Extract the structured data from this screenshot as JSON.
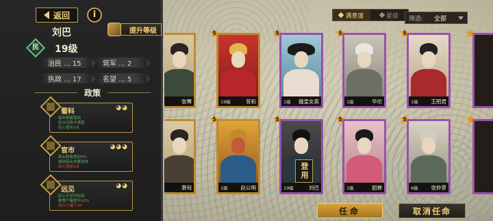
{
  "header": {
    "back_label": "返回",
    "info_label": "i",
    "hero_name": "刘巴",
    "upgrade_label": "提升等级",
    "class_label": "民",
    "level": "19级"
  },
  "stats": [
    {
      "label": "治民 ... 15"
    },
    {
      "label": "筑军 ... 2"
    },
    {
      "label": "执政 ... 17"
    },
    {
      "label": "名望 ... 5"
    }
  ],
  "policy_section_title": "政策",
  "policies": [
    {
      "name": "蜀科",
      "stars": "◕◕",
      "lines": [
        "每年税赋增加",
        "民众对政令满意",
        "民心增长5点"
      ],
      "red": [
        false,
        false,
        false
      ]
    },
    {
      "name": "官市",
      "stars": "◕◕◕",
      "lines": [
        "商业税收增加5%",
        "城池商业发展加快",
        "民心增加5点"
      ],
      "red": [
        false,
        false,
        true
      ]
    },
    {
      "name": "远见",
      "stars": "◕◕",
      "lines": [
        "民心不足时加成",
        "粮食产量提升10%",
        "战斗力减少20"
      ],
      "red": [
        false,
        false,
        true
      ]
    }
  ],
  "filter": {
    "tab_loyalty": "满意度",
    "tab_star": "星级",
    "label": "筛选:",
    "value": "全部"
  },
  "cards_row1": [
    {
      "name": "张骞",
      "level": "",
      "stars": "",
      "color": "orange"
    },
    {
      "name": "昔和",
      "level": "19级",
      "stars": "5",
      "color": "orange"
    },
    {
      "name": "娥皇女英",
      "level": "1级",
      "stars": "5",
      "color": "purple"
    },
    {
      "name": "华佗",
      "level": "1级",
      "stars": "5",
      "color": "purple"
    },
    {
      "name": "王昭君",
      "level": "1级",
      "stars": "5",
      "color": "purple"
    }
  ],
  "cards_row2": [
    {
      "name": "萧何",
      "level": "",
      "stars": "",
      "color": "orange"
    },
    {
      "name": "赵公明",
      "level": "1级",
      "stars": "5",
      "color": "orange"
    },
    {
      "name": "刘巴",
      "level": "19级",
      "stars": "5",
      "color": "purple",
      "stamp": "登用"
    },
    {
      "name": "貂蝉",
      "level": "1级",
      "stars": "5",
      "color": "purple"
    },
    {
      "name": "张仲景",
      "level": "6级",
      "stars": "5",
      "color": "purple"
    }
  ],
  "buttons": {
    "appoint": "任命",
    "cancel": "取消任命"
  }
}
